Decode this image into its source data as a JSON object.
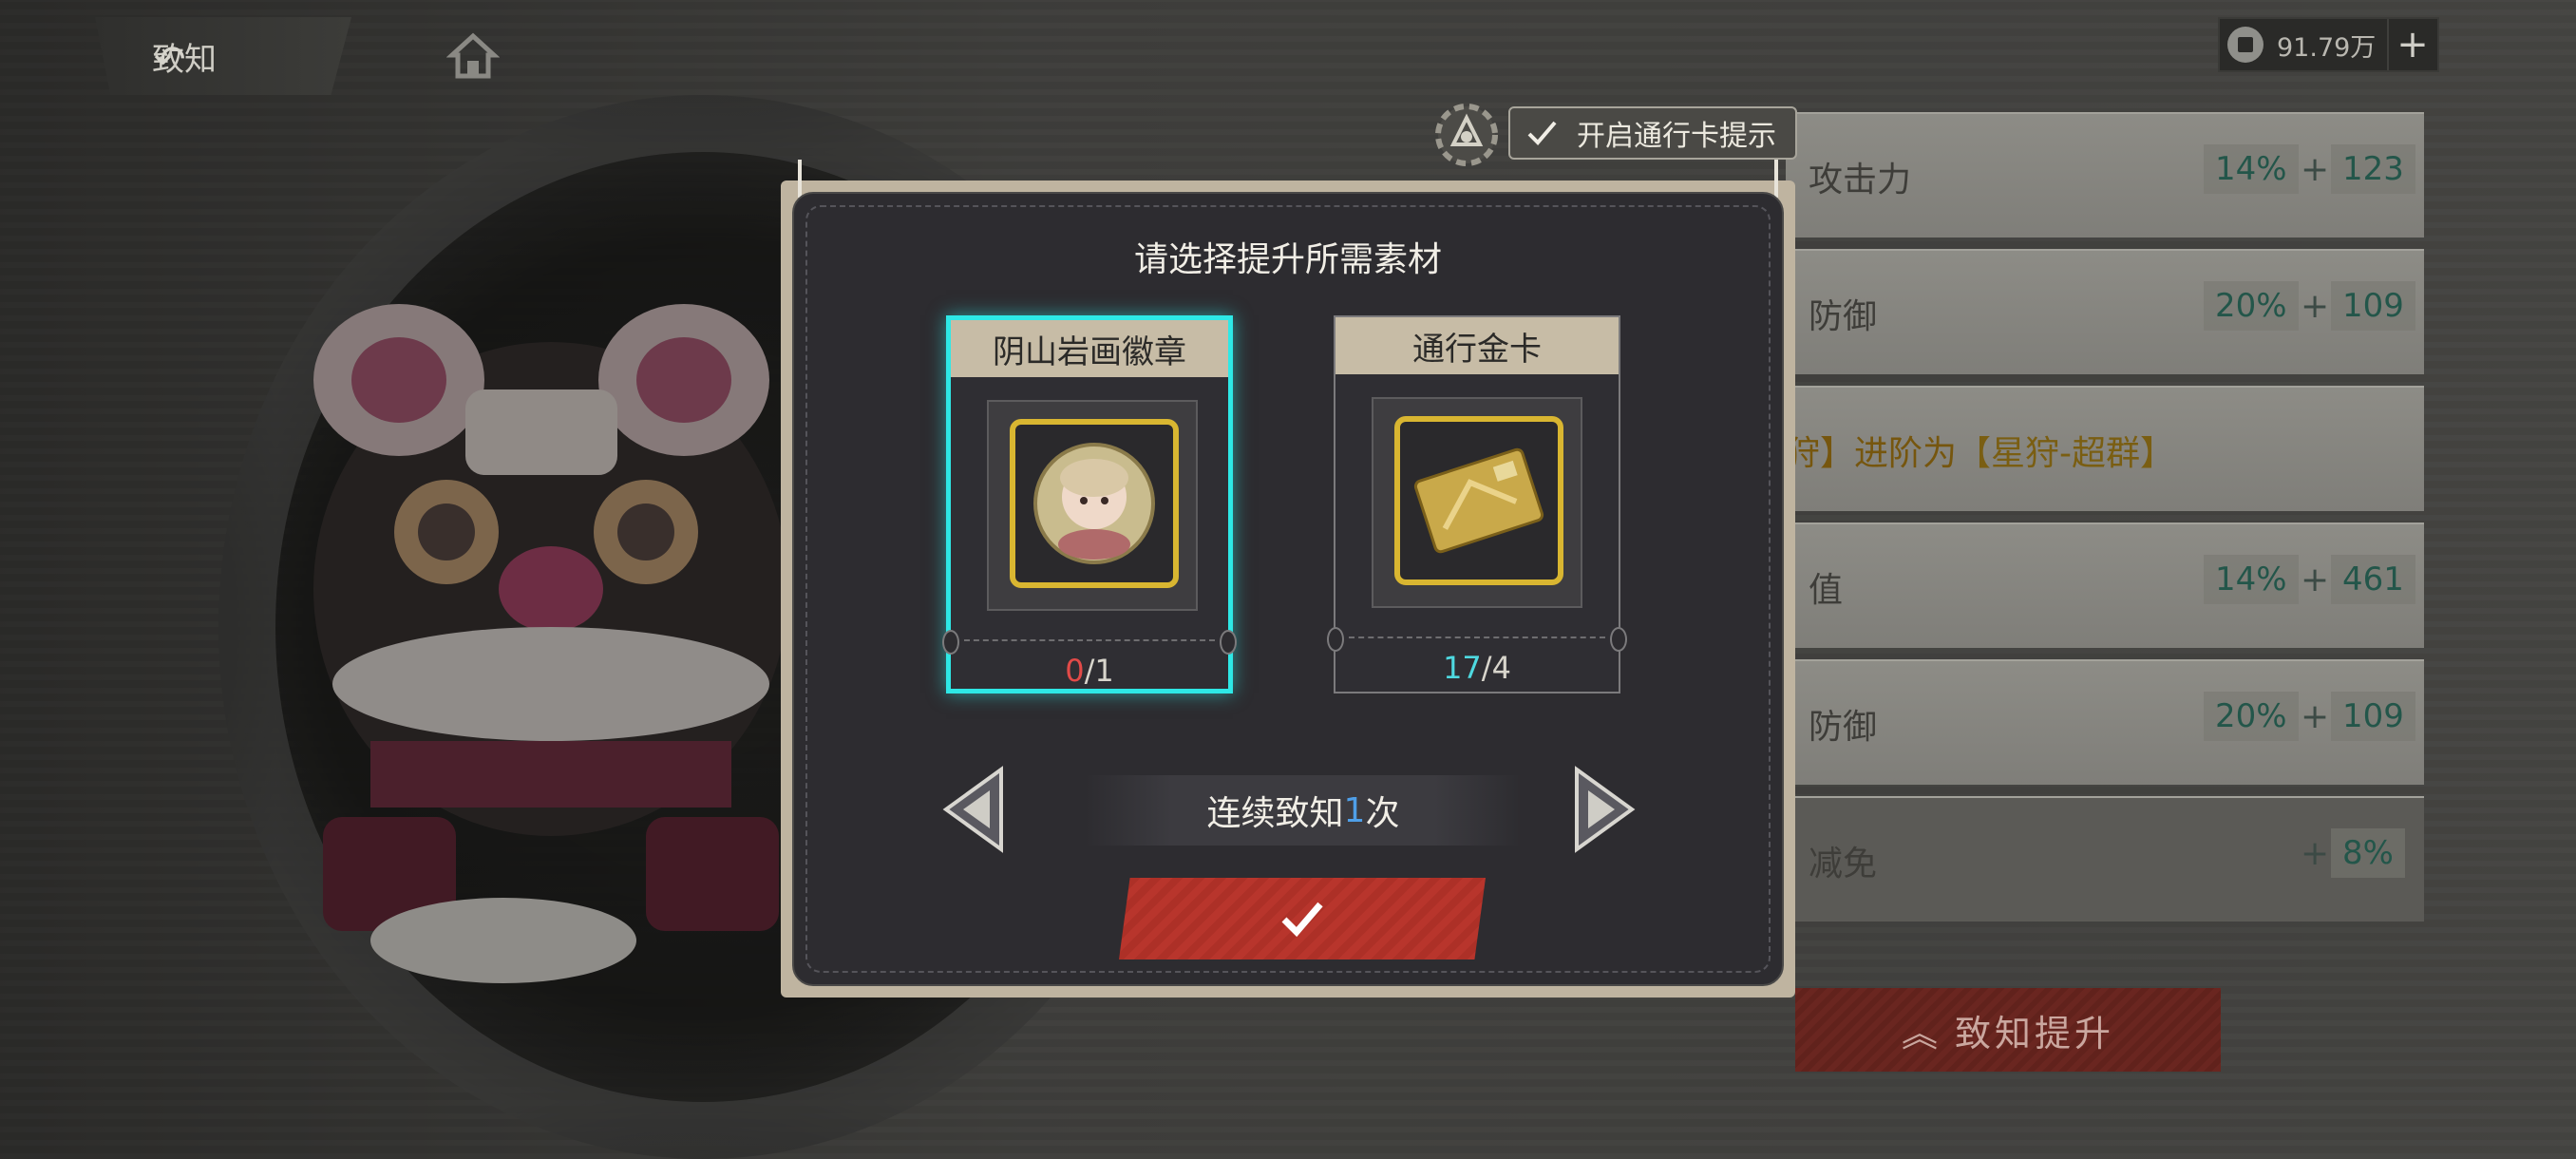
{
  "header": {
    "back_label": "致知",
    "currency_value": "91.79万",
    "add_label": "+"
  },
  "pass_hint": {
    "label": "开启通行卡提示",
    "checked": true
  },
  "stats": [
    {
      "label": "攻击力",
      "pct": "14%",
      "plus": "+",
      "value": "123"
    },
    {
      "label": "防御",
      "pct": "20%",
      "plus": "+",
      "value": "109"
    },
    {
      "evolve_prefix": "狩】进阶为",
      "evolve_target": "【星狩-超群】"
    },
    {
      "label": "值",
      "pct": "14%",
      "plus": "+",
      "value": "461"
    },
    {
      "label": "防御",
      "pct": "20%",
      "plus": "+",
      "value": "109"
    },
    {
      "label": "减免",
      "plus": "+",
      "value": "8%"
    }
  ],
  "upgrade_button": "致知提升",
  "dialog": {
    "title": "请选择提升所需素材",
    "cards": [
      {
        "name": "阴山岩画徽章",
        "have": "0",
        "need": "/1",
        "selected": true
      },
      {
        "name": "通行金卡",
        "have": "17",
        "need": "/4",
        "selected": false
      }
    ],
    "repeat_prefix": "连续致知",
    "repeat_count": "1",
    "repeat_suffix": "次"
  },
  "colors": {
    "accent_cyan": "#2ee8e6",
    "confirm_red": "#b8352c",
    "count_red": "#e24a48"
  }
}
